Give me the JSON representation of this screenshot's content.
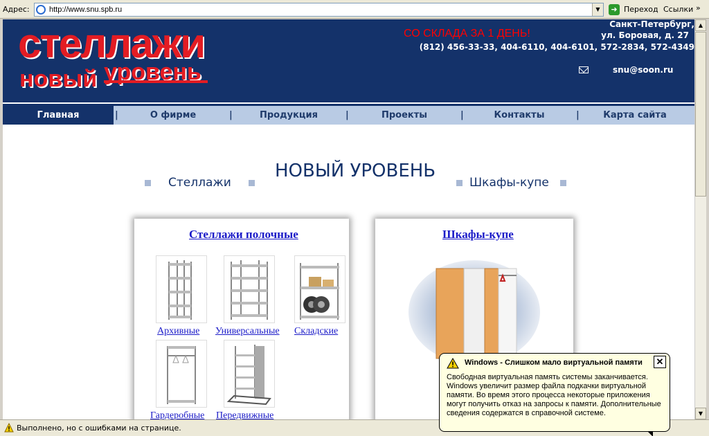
{
  "browser": {
    "address_label": "Адрес:",
    "url": "http://www.snu.spb.ru",
    "go_label": "Переход",
    "links_label": "Ссылки",
    "chevron": "»"
  },
  "header": {
    "logo_line1": "стеллажи",
    "logo_line2a": "новый",
    "logo_line2b": "уровень",
    "slogan": "СО СКЛАДА ЗА 1 ДЕНЬ!",
    "city": "Санкт-Петербург,",
    "street": "ул. Боровая, д. 27",
    "phones": "(812) 456-33-33, 404-6110, 404-6101, 572-2834, 572-4349",
    "email": "snu@soon.ru"
  },
  "nav": {
    "items": [
      "Главная",
      "О фирме",
      "Продукция",
      "Проекты",
      "Контакты",
      "Карта сайта"
    ],
    "separator": "|"
  },
  "main": {
    "title": "НОВЫЙ УРОВЕНЬ",
    "sub_left": "Стеллажи",
    "sub_right": "Шкафы-купе"
  },
  "cards": {
    "left": {
      "title": "Стеллажи полочные",
      "items": [
        "Архивные",
        "Универсальные",
        "Складские",
        "Гардеробные",
        "Передвижные"
      ]
    },
    "right": {
      "title": "Шкафы-купе"
    }
  },
  "status": {
    "text": "Выполнено, но с ошибками на странице."
  },
  "balloon": {
    "title": "Windows - Слишком мало виртуальной памяти",
    "close": "✕",
    "text": "Свободная виртуальная память системы заканчивается. Windows увеличит размер файла подкачки виртуальной памяти. Во время этого процесса некоторые приложения могут получить отказ на запросы к памяти. Дополнительные сведения содержатся в справочной системе."
  }
}
